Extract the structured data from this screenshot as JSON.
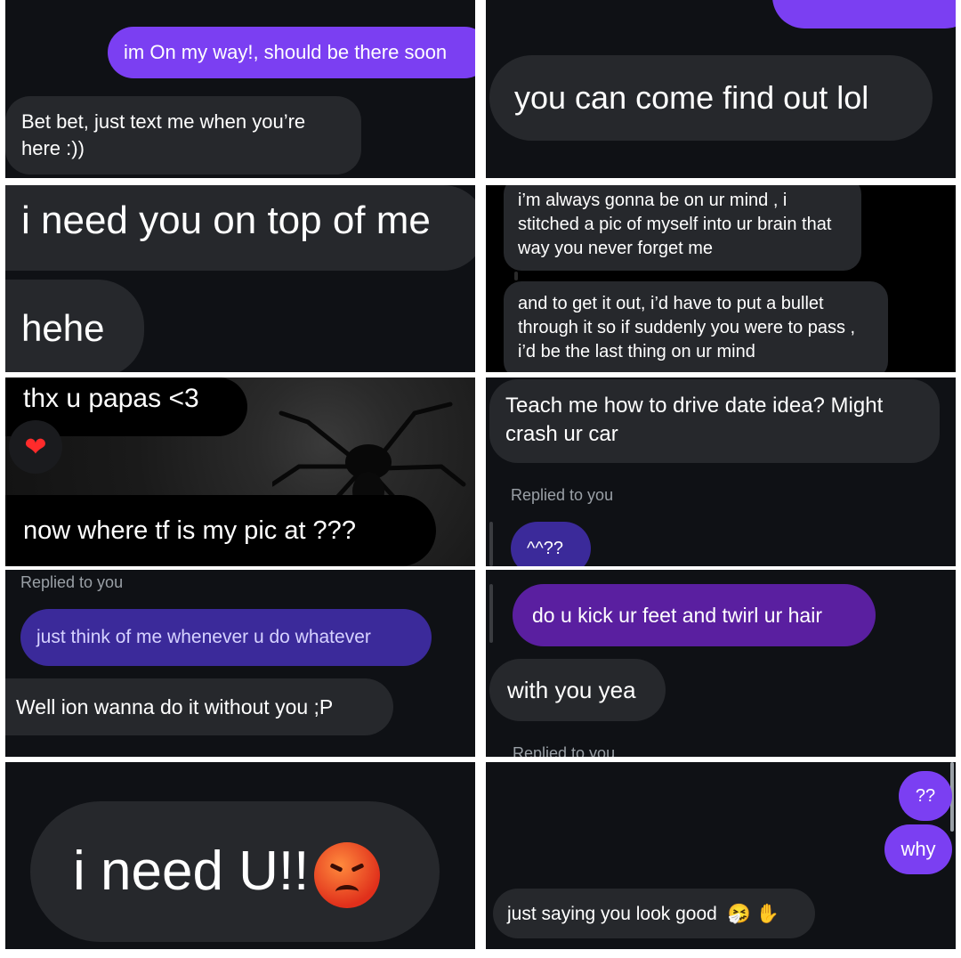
{
  "tiles": {
    "t1": {
      "sent": "im On my way!, should be there soon",
      "recv": "Bet bet, just text me when you’re here :))"
    },
    "t2": {
      "recv": "you can come find out lol"
    },
    "t3": {
      "line1": "i need you on top of me",
      "line2": "hehe"
    },
    "t4": {
      "msg1": "i’m always gonna be on ur mind , i stitched a pic of myself into ur brain that way you never forget me",
      "msg2": "and to get it out, i’d have to put a bullet through it so if suddenly you were to pass , i’d be the last thing on ur mind"
    },
    "t5": {
      "msg1": "thx u papas <3",
      "reaction_icon": "heart-icon",
      "msg2": "now where tf is my pic at ???"
    },
    "t6": {
      "msg1": "Teach me how to drive date idea? Might crash ur car",
      "replied": "Replied to you",
      "msg2": "^^??"
    },
    "t7": {
      "replied": "Replied to you",
      "sent": "just think of me whenever u do whatever",
      "recv": "Well ion wanna do it without you ;P"
    },
    "t8": {
      "sent": "do u kick ur feet and twirl ur hair",
      "recv": "with you yea",
      "replied": "Replied to you"
    },
    "t9": {
      "msg": "i need U!!",
      "emoji_icon": "angry-face-icon"
    },
    "t10": {
      "sent1": "??",
      "sent2": "why",
      "recv": "just saying you look good",
      "emoji1": "🤧",
      "emoji2": "✋"
    }
  },
  "colors": {
    "tile_bg": "#0f1115",
    "received_bubble": "#26282c",
    "sent_bubble": "#7b3ff2",
    "sent_bubble_dark": "#3b2a9a",
    "sent_bubble_purple": "#5a1fa0"
  }
}
